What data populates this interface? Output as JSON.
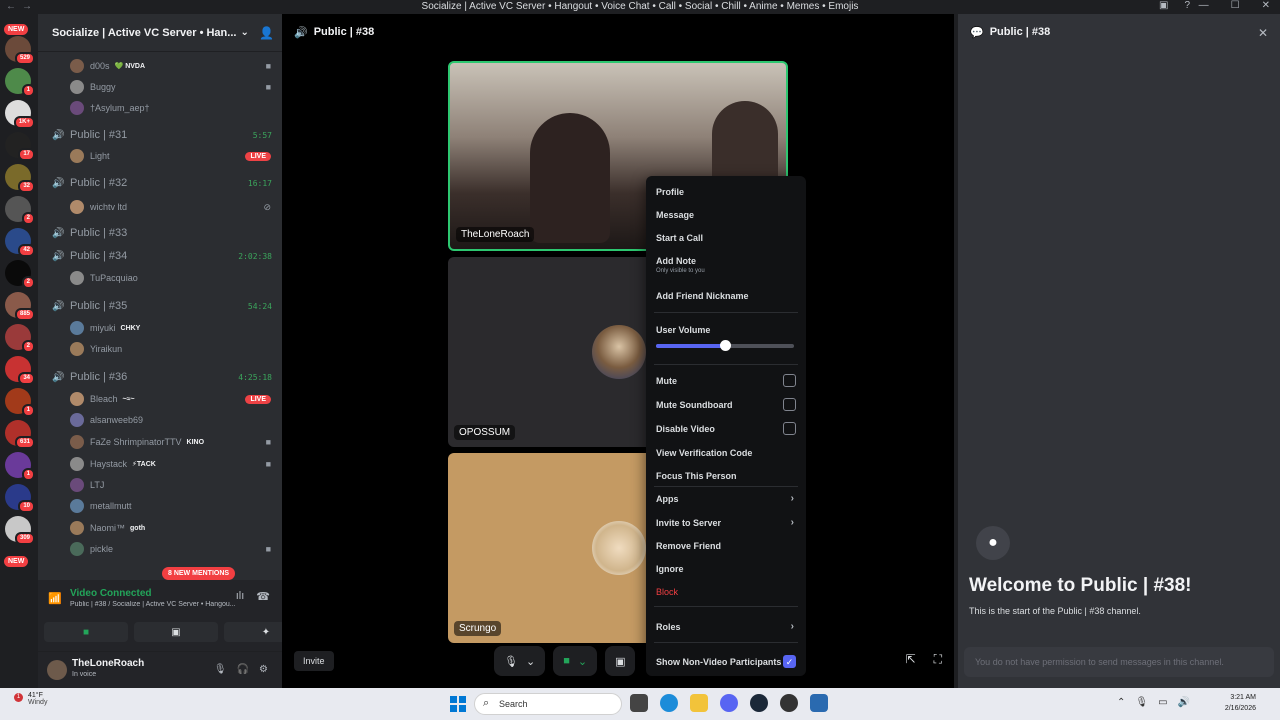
{
  "titlebar": {
    "title": "Socialize | Active VC Server • Hangout • Voice Chat • Call • Social • Chill • Anime • Memes • Emojis",
    "back": "←",
    "forward": "→"
  },
  "rail": {
    "top_pill": "NEW",
    "bottom_pill": "NEW",
    "badges": [
      "529",
      "1",
      "1K+",
      "17",
      "32",
      "2",
      "42",
      "2",
      "885",
      "2",
      "34",
      "1",
      "631",
      "1",
      "10",
      "309"
    ]
  },
  "server": {
    "name": "Socialize | Active VC Server • Han..."
  },
  "channels": [
    {
      "type": "member",
      "name": "d00s",
      "tag": "💚 NVDA",
      "icon": "cam"
    },
    {
      "type": "member",
      "name": "Buggy",
      "icon": "cam"
    },
    {
      "type": "member",
      "name": "†Asylum_aep†"
    },
    {
      "type": "voice",
      "name": "Public | #31",
      "timer": "5:57"
    },
    {
      "type": "member",
      "name": "Light",
      "icon": "live"
    },
    {
      "type": "voice",
      "name": "Public | #32",
      "timer": "16:17"
    },
    {
      "type": "member",
      "name": "wichtv ltd",
      "icon": "mute"
    },
    {
      "type": "voice",
      "name": "Public | #33",
      "muted": true
    },
    {
      "type": "voice",
      "name": "Public | #34",
      "timer": "2:02:38"
    },
    {
      "type": "member",
      "name": "TuPacquiao"
    },
    {
      "type": "voice",
      "name": "Public | #35",
      "timer": "54:24"
    },
    {
      "type": "member",
      "name": "miyuki",
      "tag": "CHKY"
    },
    {
      "type": "member",
      "name": "Yiraikun"
    },
    {
      "type": "voice",
      "name": "Public | #36",
      "timer": "4:25:18"
    },
    {
      "type": "member",
      "name": "Bleach",
      "tag": "~≈~",
      "icon": "live"
    },
    {
      "type": "member",
      "name": "alsanweeb69"
    },
    {
      "type": "member",
      "name": "FaZe ShrimpinatorTTV",
      "tag": "KINO",
      "icon": "cam"
    },
    {
      "type": "member",
      "name": "Haystack",
      "tag": "⚡TACK",
      "icon": "cam"
    },
    {
      "type": "member",
      "name": "LTJ"
    },
    {
      "type": "member",
      "name": "metallmutt"
    },
    {
      "type": "member",
      "name": "Naomi™",
      "tag": "goth"
    },
    {
      "type": "member",
      "name": "pickle",
      "icon": "cam"
    }
  ],
  "mentions_pill": "8 NEW MENTIONS",
  "voice_panel": {
    "status": "Video Connected",
    "subtitle": "Public | #38 / Socialize | Active VC Server • Hangou..."
  },
  "user": {
    "name": "TheLoneRoach",
    "status": "In voice"
  },
  "stage": {
    "channel": "Public | #38",
    "tiles": [
      "TheLoneRoach",
      "OPOSSUM",
      "Scrungo"
    ],
    "invite": "Invite"
  },
  "menu": {
    "profile": "Profile",
    "message": "Message",
    "start_call": "Start a Call",
    "add_note": "Add Note",
    "add_note_sub": "Only visible to you",
    "add_friend_nickname": "Add Friend Nickname",
    "user_volume": "User Volume",
    "user_volume_level": 0.5,
    "mute": "Mute",
    "mute_soundboard": "Mute Soundboard",
    "disable_video": "Disable Video",
    "view_verification": "View Verification Code",
    "focus": "Focus This Person",
    "apps": "Apps",
    "invite_server": "Invite to Server",
    "remove_friend": "Remove Friend",
    "ignore": "Ignore",
    "block": "Block",
    "roles": "Roles",
    "show_non_video": "Show Non-Video Participants"
  },
  "chat": {
    "channel": "Public | #38",
    "welcome_title": "Welcome to Public | #38!",
    "welcome_sub": "This is the start of the Public | #38 channel.",
    "input_placeholder": "You do not have permission to send messages in this channel."
  },
  "taskbar": {
    "temp": "41°F",
    "weather": "Windy",
    "weather_badge": "1",
    "search": "Search",
    "time": "3:21 AM",
    "date": "2/16/2026"
  },
  "colors": {
    "accent": "#5865f2",
    "green": "#23a55a",
    "danger": "#f23f42"
  }
}
